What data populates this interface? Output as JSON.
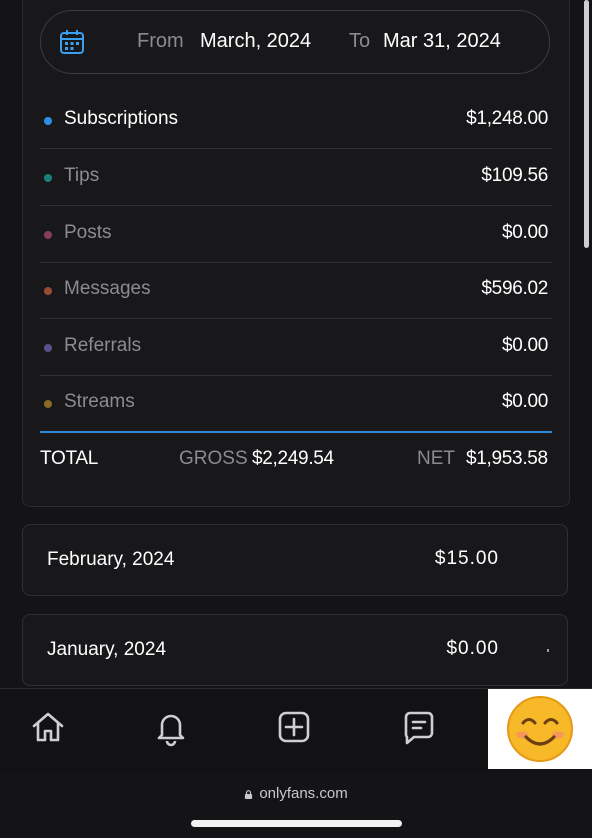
{
  "date_range": {
    "from_label": "From",
    "from_value": "March, 2024",
    "to_label": "To",
    "to_value": "Mar 31, 2024",
    "icon": "calendar-icon"
  },
  "categories": [
    {
      "label": "Subscriptions",
      "amount": "$1,248.00",
      "color": "#2f8fe8"
    },
    {
      "label": "Tips",
      "amount": "$109.56",
      "color": "#1a7f78"
    },
    {
      "label": "Posts",
      "amount": "$0.00",
      "color": "#8a3a5c"
    },
    {
      "label": "Messages",
      "amount": "$596.02",
      "color": "#9a4b34"
    },
    {
      "label": "Referrals",
      "amount": "$0.00",
      "color": "#5a4f8c"
    },
    {
      "label": "Streams",
      "amount": "$0.00",
      "color": "#8a6a24"
    }
  ],
  "totals": {
    "total_label": "TOTAL",
    "gross_label": "GROSS",
    "gross_value": "$2,249.54",
    "net_label": "NET",
    "net_value": "$1,953.58"
  },
  "months": [
    {
      "label": "February, 2024",
      "amount": "$15.00"
    },
    {
      "label": "January, 2024",
      "amount": "$0.00"
    }
  ],
  "nav": {
    "items": [
      "home-icon",
      "bell-icon",
      "add-square-icon",
      "messages-icon",
      "avatar-emoji"
    ],
    "avatar_glyph": "😊"
  },
  "browser": {
    "url": "onlyfans.com"
  },
  "colors": {
    "accent": "#2f88d8",
    "background": "#141416"
  }
}
